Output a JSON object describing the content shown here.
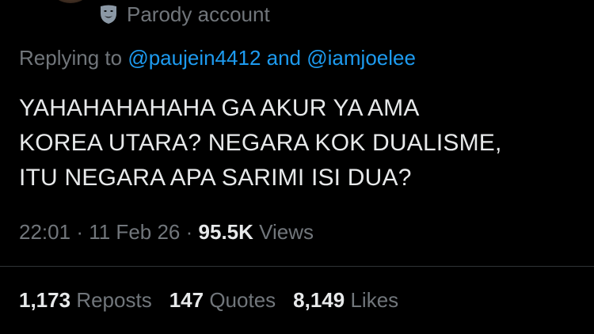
{
  "header": {
    "avatar_icon": "avatar-photo",
    "badge_icon": "theater-mask-icon",
    "badge_label": "Parody account"
  },
  "reply": {
    "prefix": "Replying to",
    "mention_1": "@paujein4412",
    "connector": "and",
    "mention_2": "@iamjoelee"
  },
  "tweet": {
    "lines": [
      "YAHAHAHAHAHA GA AKUR YA AMA",
      "KOREA UTARA? NEGARA KOK DUALISME,",
      "ITU NEGARA APA SARIMI ISI DUA?"
    ]
  },
  "meta": {
    "time": "22:01",
    "separator_1": "·",
    "date": "11 Feb 26",
    "separator_2": "·",
    "views_count": "95.5K",
    "views_label": "Views"
  },
  "stats": {
    "reposts_count": "1,173",
    "reposts_label": "Reposts",
    "quotes_count": "147",
    "quotes_label": "Quotes",
    "likes_count": "8,149",
    "likes_label": "Likes"
  },
  "colors": {
    "background": "#000000",
    "text_primary": "#e7e9ea",
    "text_secondary": "#71767b",
    "link": "#1d9bf0",
    "divider": "#2f3336"
  }
}
